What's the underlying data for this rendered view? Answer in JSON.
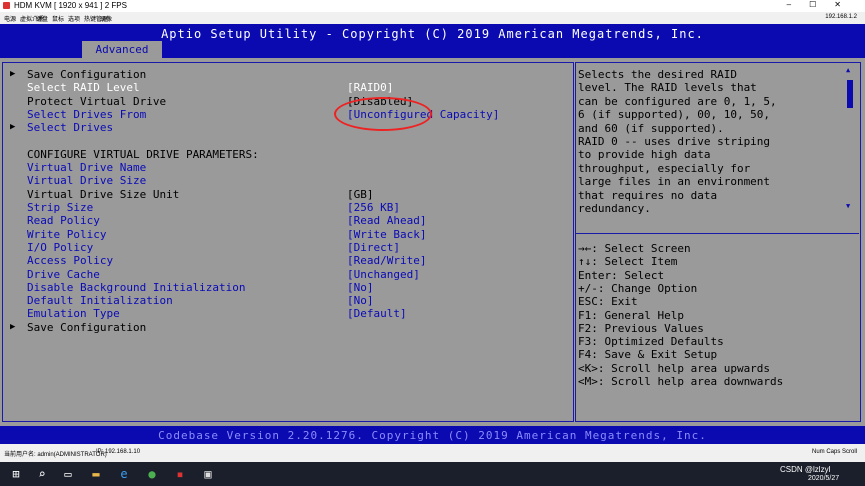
{
  "kvm": {
    "title": "HDM KVM   [ 1920 x 941 ]   2 FPS",
    "menu_items": [
      "电源",
      "虚拟介质",
      "键盘",
      "鼠标",
      "选项",
      "热键管理",
      "录像"
    ],
    "ip": "192.168.1.2"
  },
  "bios": {
    "title": "Aptio Setup Utility - Copyright (C) 2019 American Megatrends, Inc.",
    "active_tab": "Advanced",
    "footer": "Codebase Version 2.20.1276. Copyright (C) 2019 American Megatrends, Inc.",
    "items": [
      {
        "label": "Save Configuration",
        "value": "",
        "arrow": true,
        "color": "dark"
      },
      {
        "label": "Select RAID Level",
        "value": "[RAID0]",
        "arrow": false,
        "color": "white"
      },
      {
        "label": "Protect Virtual Drive",
        "value": "[Disabled]",
        "arrow": false,
        "color": "dark"
      },
      {
        "label": "Select Drives From",
        "value": "[Unconfigured Capacity]",
        "arrow": false,
        "color": "blue"
      },
      {
        "label": "Select Drives",
        "value": "",
        "arrow": true,
        "color": "blue"
      },
      {
        "label": "",
        "value": "",
        "arrow": false,
        "color": "dark"
      },
      {
        "label": "CONFIGURE VIRTUAL DRIVE PARAMETERS:",
        "value": "",
        "arrow": false,
        "color": "dark"
      },
      {
        "label": "Virtual Drive Name",
        "value": "",
        "arrow": false,
        "color": "blue"
      },
      {
        "label": "Virtual Drive Size",
        "value": "",
        "arrow": false,
        "color": "blue"
      },
      {
        "label": "Virtual Drive Size Unit",
        "value": "[GB]",
        "arrow": false,
        "color": "dark"
      },
      {
        "label": "Strip Size",
        "value": "[256 KB]",
        "arrow": false,
        "color": "blue"
      },
      {
        "label": "Read Policy",
        "value": "[Read Ahead]",
        "arrow": false,
        "color": "blue"
      },
      {
        "label": "Write Policy",
        "value": "[Write Back]",
        "arrow": false,
        "color": "blue"
      },
      {
        "label": "I/O Policy",
        "value": "[Direct]",
        "arrow": false,
        "color": "blue"
      },
      {
        "label": "Access Policy",
        "value": "[Read/Write]",
        "arrow": false,
        "color": "blue"
      },
      {
        "label": "Drive Cache",
        "value": "[Unchanged]",
        "arrow": false,
        "color": "blue"
      },
      {
        "label": "Disable Background Initialization",
        "value": "[No]",
        "arrow": false,
        "color": "blue"
      },
      {
        "label": "Default Initialization",
        "value": "[No]",
        "arrow": false,
        "color": "blue"
      },
      {
        "label": "Emulation Type",
        "value": "[Default]",
        "arrow": false,
        "color": "blue"
      },
      {
        "label": "Save Configuration",
        "value": "",
        "arrow": true,
        "color": "dark"
      }
    ],
    "help_lines": [
      "Selects the desired RAID",
      "level. The RAID levels that",
      "can be configured are 0, 1, 5,",
      "6 (if supported), 00, 10, 50,",
      "and 60 (if supported).",
      "RAID 0 -- uses drive striping",
      "to provide high data",
      "throughput, especially for",
      "large files in an environment",
      "that requires no data",
      "redundancy."
    ],
    "key_lines": [
      "→←: Select Screen",
      "↑↓: Select Item",
      "Enter: Select",
      "+/-: Change Option",
      "ESC: Exit",
      "F1: General Help",
      "F2: Previous Values",
      "F3: Optimized Defaults",
      "F4: Save & Exit Setup",
      "<K>: Scroll help area upwards",
      "<M>: Scroll help area downwards"
    ]
  },
  "status": {
    "user": "当前用户名: admin(ADMINISTRATOR)",
    "ip": "IP: 192.168.1.10",
    "right": "Num  Caps  Scroll"
  },
  "tray": {
    "watermark": "CSDN @lzlzyl",
    "date": "2020/5/27"
  }
}
